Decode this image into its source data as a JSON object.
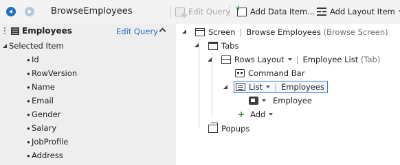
{
  "toolbar": {
    "screen_name": "BrowseEmployees",
    "edit_query": "Edit Query",
    "add_data_item": "Add Data Item...",
    "add_layout_item": "Add Layout Item"
  },
  "left_panel": {
    "title": "Employees",
    "edit_query_link": "Edit Query",
    "group_label": "Selected Item",
    "fields": [
      "Id",
      "RowVersion",
      "Name",
      "Email",
      "Gender",
      "Salary",
      "JobProfile",
      "Address"
    ]
  },
  "tree": {
    "screen": {
      "label": "Screen",
      "name": "Browse Employees",
      "kind": "(Browse Screen)"
    },
    "tabs": {
      "label": "Tabs"
    },
    "rows_layout": {
      "label": "Rows Layout",
      "name": "Employee List",
      "kind": "(Tab)"
    },
    "command_bar": {
      "label": "Command Bar"
    },
    "list": {
      "label": "List",
      "name": "Employees"
    },
    "employee": {
      "label": "Employee"
    },
    "add": {
      "label": "Add"
    },
    "popups": {
      "label": "Popups"
    }
  },
  "colors": {
    "accent": "#1f6fc0",
    "panel_bg": "#eeeeee",
    "toolbar_bg": "#f3f3f3",
    "add_green": "#2c8a2c"
  }
}
